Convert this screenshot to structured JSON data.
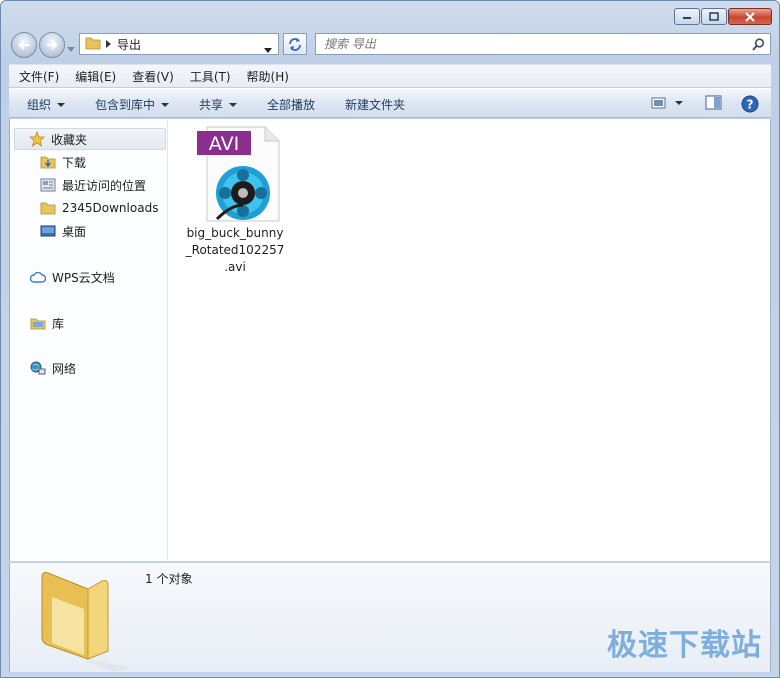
{
  "address": {
    "crumb": "导出"
  },
  "search": {
    "placeholder": "搜索 导出"
  },
  "menu": [
    {
      "label": "文件(F)"
    },
    {
      "label": "编辑(E)"
    },
    {
      "label": "查看(V)"
    },
    {
      "label": "工具(T)"
    },
    {
      "label": "帮助(H)"
    }
  ],
  "toolbar": {
    "organize": "组织",
    "include_library": "包含到库中",
    "share": "共享",
    "play_all": "全部播放",
    "new_folder": "新建文件夹"
  },
  "nav": {
    "favorites": "收藏夹",
    "downloads": "下载",
    "recent": "最近访问的位置",
    "downloads2345": "2345Downloads",
    "desktop": "桌面",
    "wps": "WPS云文档",
    "libraries": "库",
    "network": "网络"
  },
  "file": {
    "badge": "AVI",
    "name_line1": "big_buck_bunny",
    "name_line2": "_Rotated102257",
    "name_line3": ".avi"
  },
  "details": {
    "count": "1 个对象"
  },
  "watermark": "极速下载站",
  "colors": {
    "avi_badge": "#8b2f8f",
    "accent": "#1f3a5c"
  }
}
